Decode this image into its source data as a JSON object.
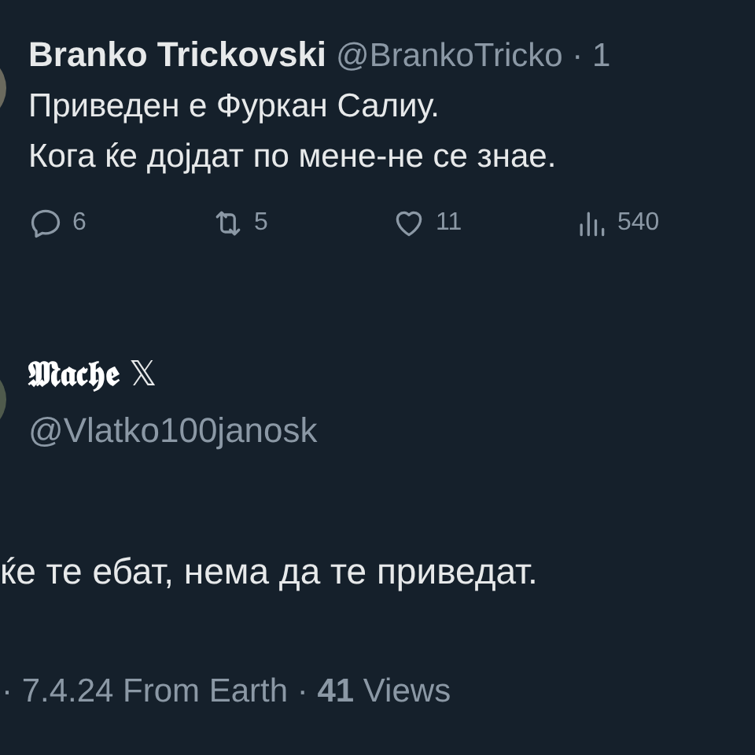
{
  "tweet": {
    "name": "Branko Trickovski",
    "handle_time": "@BrankoTricko · 1",
    "lines": [
      "Приведен е Фуркан Салиу.",
      "Кога ќе дојдат по мене-не се знае."
    ],
    "stats": [
      {
        "kind": "reply",
        "count": "6"
      },
      {
        "kind": "repost",
        "count": "5"
      },
      {
        "kind": "like",
        "count": "11"
      },
      {
        "kind": "views",
        "count": "540"
      }
    ]
  },
  "reply": {
    "name": "𝕸𝖆𝖈𝖍𝖊",
    "name_badge": "𝕏",
    "handle": "@Vlatko100janosk",
    "text": "ќе те ебат, нема да те приведат.",
    "meta": "· 7.4.24 From Earth · **41** Views"
  }
}
